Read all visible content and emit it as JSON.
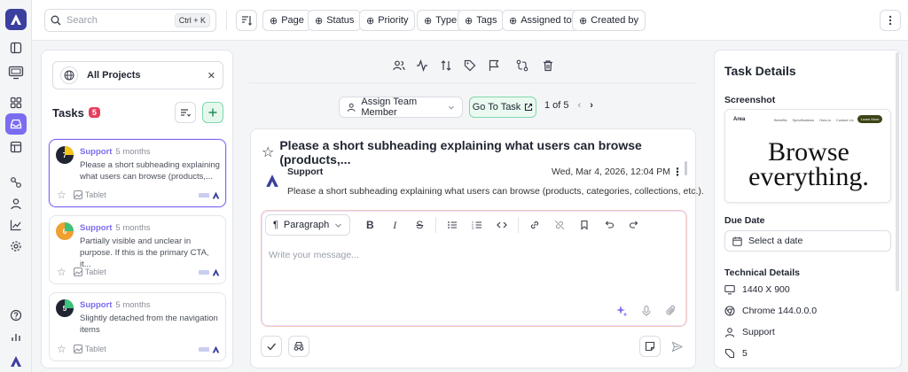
{
  "search": {
    "placeholder": "Search",
    "shortcut": "Ctrl + K"
  },
  "filters": {
    "page": "Page",
    "status": "Status",
    "priority": "Priority",
    "type": "Type",
    "tags": "Tags",
    "assigned_to": "Assigned to",
    "created_by": "Created by"
  },
  "tasks_panel": {
    "project": "All Projects",
    "title": "Tasks",
    "count": "5",
    "cards": [
      {
        "number": "7",
        "team": "Support",
        "ago": "5 months",
        "desc": "Please a short subheading explaining what users can browse (products,...",
        "device": "Tablet",
        "avatar_color": "#1f2430",
        "accent": "#f5c518"
      },
      {
        "number": "6",
        "team": "Support",
        "ago": "5 months",
        "desc": "Partially visible and unclear in purpose. If this is the primary CTA, it...",
        "device": "Tablet",
        "avatar_color": "#f0a030",
        "accent": "#3cc27a"
      },
      {
        "number": "5",
        "team": "Support",
        "ago": "5 months",
        "desc": "Slightly detached from the navigation items",
        "device": "Tablet",
        "avatar_color": "#1f2430",
        "accent": "#3cc27a"
      }
    ]
  },
  "center": {
    "assign_label": "Assign Team Member",
    "goto_label": "Go To Task",
    "pager": "1 of 5",
    "task_title": "Please a short subheading explaining what users can browse (products,...",
    "comment": {
      "author": "Support",
      "date": "Wed, Mar 4, 2026, 12:04 PM",
      "text": "Please a short subheading explaining what users can browse (products, categories, collections, etc.)."
    },
    "editor": {
      "format": "Paragraph",
      "placeholder": "Write your message..."
    }
  },
  "details": {
    "title": "Task Details",
    "screenshot_label": "Screenshot",
    "screenshot": {
      "logo": "Area",
      "nav": [
        "Benefits",
        "Specifications",
        "How-to",
        "Contact Us"
      ],
      "cta": "Learn More",
      "headline_1": "Browse",
      "headline_2": "everything."
    },
    "due_label": "Due Date",
    "due_placeholder": "Select a date",
    "tech_label": "Technical Details",
    "tech": [
      {
        "icon": "monitor-icon",
        "value": "1440 X 900"
      },
      {
        "icon": "chrome-icon",
        "value": "Chrome 144.0.0.0"
      },
      {
        "icon": "user-icon",
        "value": "Support"
      },
      {
        "icon": "tag-icon",
        "value": "5"
      }
    ]
  },
  "colors": {
    "accent": "#7b6cf0",
    "brand": "#3b3f9e",
    "success_border": "#7fd9a9",
    "badge": "#e63e5c"
  }
}
